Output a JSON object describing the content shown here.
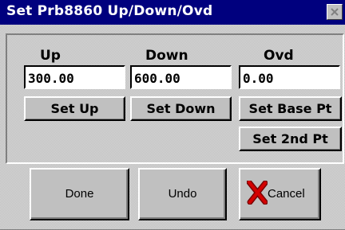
{
  "window": {
    "title": "Set Prb8860 Up/Down/Ovd"
  },
  "labels": {
    "up": "Up",
    "down": "Down",
    "ovd": "Ovd"
  },
  "fields": {
    "up_value": "300.00",
    "down_value": "600.00",
    "ovd_value": "0.00"
  },
  "buttons": {
    "set_up": "Set Up",
    "set_down": "Set Down",
    "set_base_pt": "Set Base Pt",
    "set_2nd_pt": "Set 2nd Pt",
    "done": "Done",
    "undo": "Undo",
    "cancel": "Cancel"
  },
  "icons": {
    "close": "close-icon",
    "cancel": "red-x-icon"
  },
  "colors": {
    "titlebar": "#00007e",
    "cancel_x": "#c00000"
  }
}
